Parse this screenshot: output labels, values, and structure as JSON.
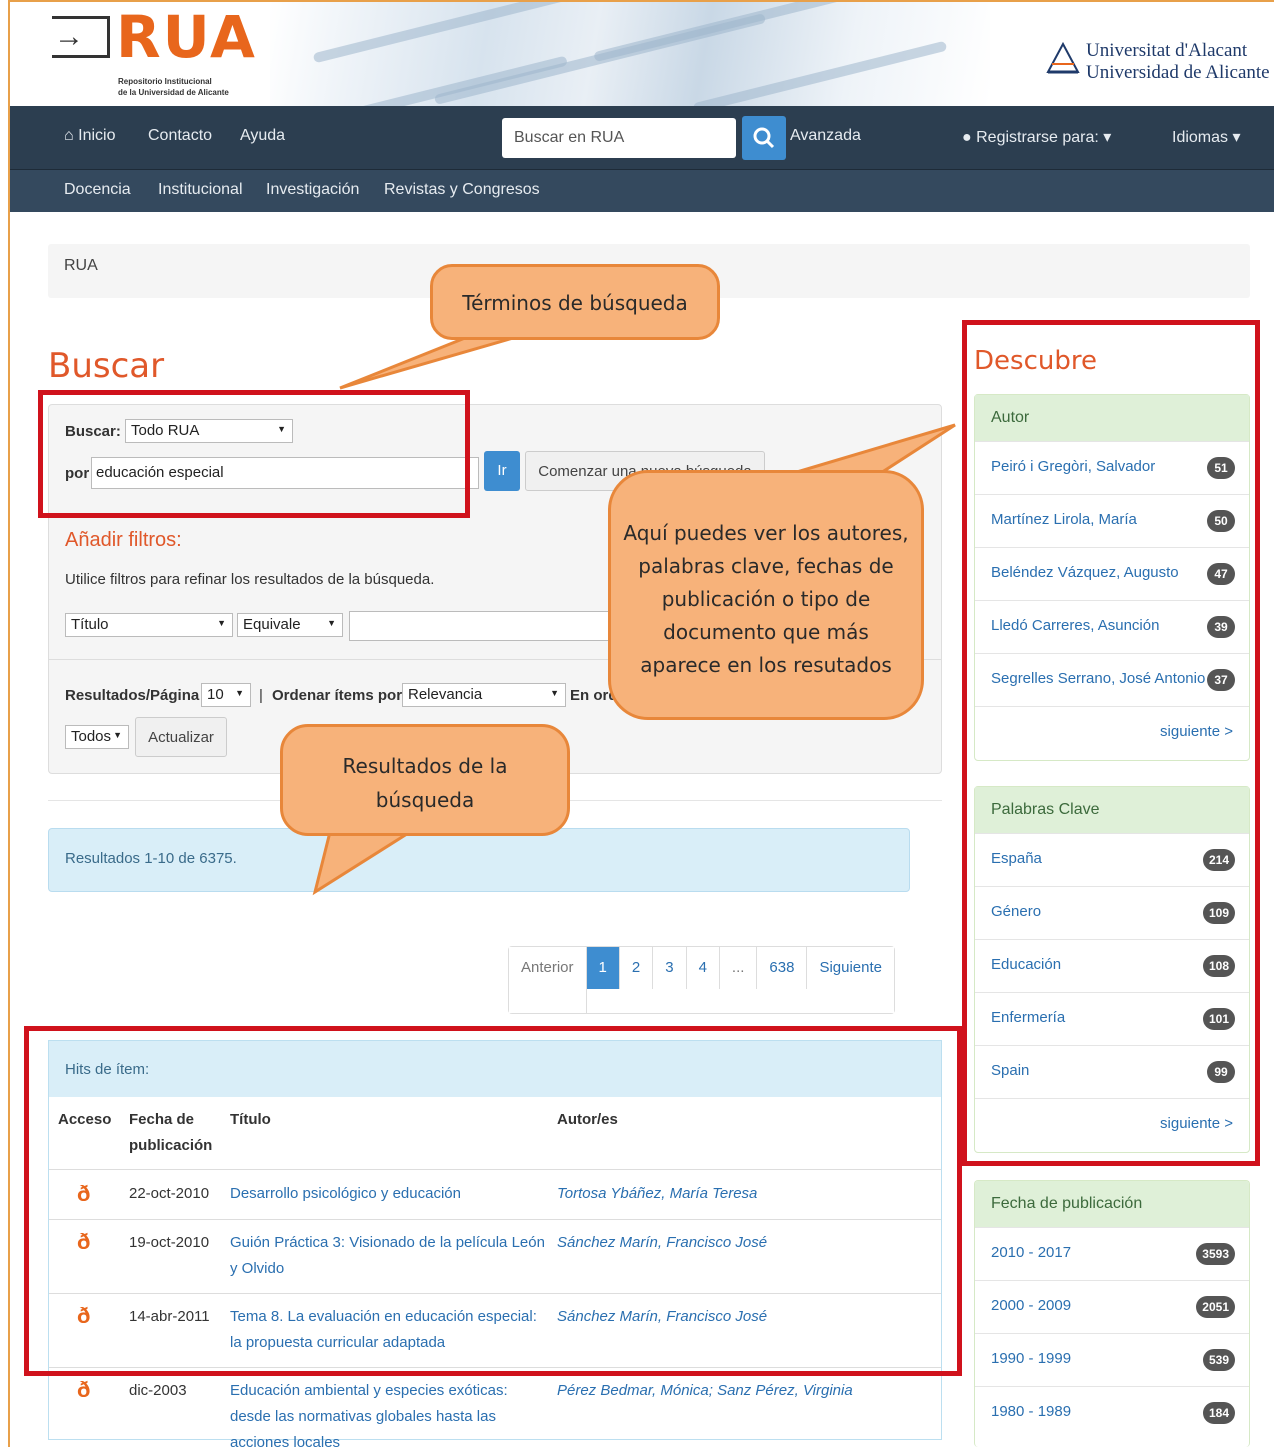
{
  "header": {
    "logo_text": "RUA",
    "logo_sub1": "Repositorio Institucional",
    "logo_sub2": "de la Universidad de Alicante",
    "univ_line1": "Universitat d'Alacant",
    "univ_line2": "Universidad de Alicante"
  },
  "nav": {
    "home": "Inicio",
    "contact": "Contacto",
    "help": "Ayuda",
    "search_placeholder": "Buscar en RUA",
    "advanced": "Avanzada",
    "register": "Registrarse para:",
    "languages": "Idiomas",
    "sub": [
      "Docencia",
      "Institucional",
      "Investigación",
      "Revistas y Congresos"
    ]
  },
  "breadcrumb": "RUA",
  "search": {
    "heading": "Buscar",
    "scope_label": "Buscar:",
    "scope_value": "Todo RUA",
    "query_label": "por",
    "query_value": "educación especial",
    "go": "Ir",
    "new_search": "Comenzar una nueva búsqueda",
    "filters_heading": "Añadir filtros:",
    "filters_help": "Utilice filtros para refinar los resultados de la búsqueda.",
    "filter_field": "Título",
    "filter_op": "Equivale",
    "rpp_label": "Resultados/Página",
    "rpp_value": "10",
    "sort_label": "Ordenar ítems por",
    "sort_value": "Relevancia",
    "order_label": "En orden",
    "all_value": "Todos",
    "update": "Actualizar"
  },
  "results_summary": "Resultados 1-10 de 6375.",
  "pagination": [
    "Anterior",
    "1",
    "2",
    "3",
    "4",
    "...",
    "638",
    "Siguiente"
  ],
  "hits": {
    "heading": "Hits de ítem:",
    "col_access": "Acceso",
    "col_date_1": "Fecha de",
    "col_date_2": "publicación",
    "col_title": "Título",
    "col_authors": "Autor/es",
    "rows": [
      {
        "date": "22-oct-2010",
        "title_1": "Desarrollo psicológico y educación",
        "title_2": "",
        "title_3": "",
        "authors": "Tortosa Ybáñez, María Teresa"
      },
      {
        "date": "19-oct-2010",
        "title_1": "Guión Práctica 3: Visionado de la película León",
        "title_2": "y Olvido",
        "title_3": "",
        "authors": "Sánchez Marín, Francisco José"
      },
      {
        "date": "14-abr-2011",
        "title_1": "Tema 8. La evaluación en educación especial:",
        "title_2": "la propuesta curricular adaptada",
        "title_3": "",
        "authors": "Sánchez Marín, Francisco José"
      },
      {
        "date": "dic-2003",
        "title_1": "Educación ambiental y especies exóticas:",
        "title_2": "desde las normativas globales hasta las",
        "title_3": "acciones locales",
        "authors": "Pérez Bedmar, Mónica; Sanz Pérez, Virginia"
      }
    ]
  },
  "sidebar": {
    "heading": "Descubre",
    "authors": {
      "heading": "Autor",
      "items": [
        {
          "label": "Peiró i Gregòri, Salvador",
          "count": "51"
        },
        {
          "label": "Martínez Lirola, María",
          "count": "50"
        },
        {
          "label": "Beléndez Vázquez, Augusto",
          "count": "47"
        },
        {
          "label": "Lledó Carreres, Asunción",
          "count": "39"
        },
        {
          "label": "Segrelles Serrano, José Antonio",
          "count": "37"
        }
      ],
      "more": "siguiente >"
    },
    "keywords": {
      "heading": "Palabras Clave",
      "items": [
        {
          "label": "España",
          "count": "214"
        },
        {
          "label": "Género",
          "count": "109"
        },
        {
          "label": "Educación",
          "count": "108"
        },
        {
          "label": "Enfermería",
          "count": "101"
        },
        {
          "label": "Spain",
          "count": "99"
        }
      ],
      "more": "siguiente >"
    },
    "dates": {
      "heading": "Fecha de publicación",
      "items": [
        {
          "label": "2010 - 2017",
          "count": "3593"
        },
        {
          "label": "2000 - 2009",
          "count": "2051"
        },
        {
          "label": "1990 - 1999",
          "count": "539"
        },
        {
          "label": "1980 - 1989",
          "count": "184"
        }
      ]
    }
  },
  "annotations": {
    "terms": "Términos de búsqueda",
    "discover_1": "Aquí puedes ver los autores,",
    "discover_2": "palabras clave, fechas de",
    "discover_3": "publicación o tipo de",
    "discover_4": "documento que más",
    "discover_5": "aparece en los resutados",
    "results_1": "Resultados de la",
    "results_2": "búsqueda",
    "highlight_color": "#d0121c",
    "callout_color": "#f7b27a"
  }
}
